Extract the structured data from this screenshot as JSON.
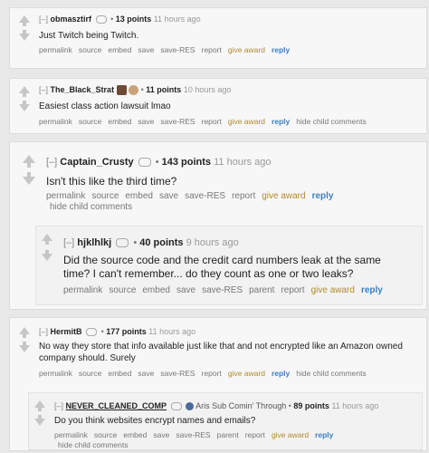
{
  "comments": [
    {
      "toggle": "[–]",
      "author": "obmasztirf",
      "points": "13 points",
      "time": "11 hours ago",
      "text": "Just Twitch being Twitch.",
      "buttons": [
        "permalink",
        "source",
        "embed",
        "save",
        "save-RES",
        "report",
        "give award",
        "reply"
      ]
    },
    {
      "toggle": "[–]",
      "author": "The_Black_Strat",
      "points": "11 points",
      "time": "10 hours ago",
      "text": "Easiest class action lawsuit lmao",
      "buttons": [
        "permalink",
        "source",
        "embed",
        "save",
        "save-RES",
        "report",
        "give award",
        "reply",
        "hide child comments"
      ]
    },
    {
      "toggle": "[–]",
      "author": "Captain_Crusty",
      "points": "143 points",
      "time": "11 hours ago",
      "text": "Isn't this like the third time?",
      "buttons": [
        "permalink",
        "source",
        "embed",
        "save",
        "save-RES",
        "report",
        "give award",
        "reply"
      ],
      "extra_button": "hide child comments"
    },
    {
      "toggle": "[–]",
      "author": "hjklhlkj",
      "points": "40 points",
      "time": "9 hours ago",
      "text_line1": "Did the source code and the credit card numbers leak at the same",
      "text_line2": "time? I can't remember... do they count as one or two leaks?",
      "buttons": [
        "permalink",
        "source",
        "embed",
        "save",
        "save-RES",
        "parent",
        "report",
        "give award",
        "reply"
      ]
    },
    {
      "toggle": "[–]",
      "author": "HermitB",
      "points": "177 points",
      "time": "11 hours ago",
      "text_line1": "No way they store that info available just like that and not encrypted like an Amazon owned",
      "text_line2": "company should. Surely",
      "buttons": [
        "permalink",
        "source",
        "embed",
        "save",
        "save-RES",
        "report",
        "give award",
        "reply",
        "hide child comments"
      ]
    },
    {
      "toggle": "[–]",
      "author": "NEVER_CLEANED_COMP",
      "flair": "Aris Sub Comin' Through",
      "points": "89 points",
      "time": "11 hours ago",
      "text": "Do you think websites encrypt names and emails?",
      "buttons": [
        "permalink",
        "source",
        "embed",
        "save",
        "save-RES",
        "parent",
        "report",
        "give award",
        "reply"
      ],
      "extra_button": "hide child comments"
    }
  ],
  "colors": {
    "award": "#b08a2a",
    "reply": "#3a7fc0",
    "arrow": "#c6c6c6"
  }
}
